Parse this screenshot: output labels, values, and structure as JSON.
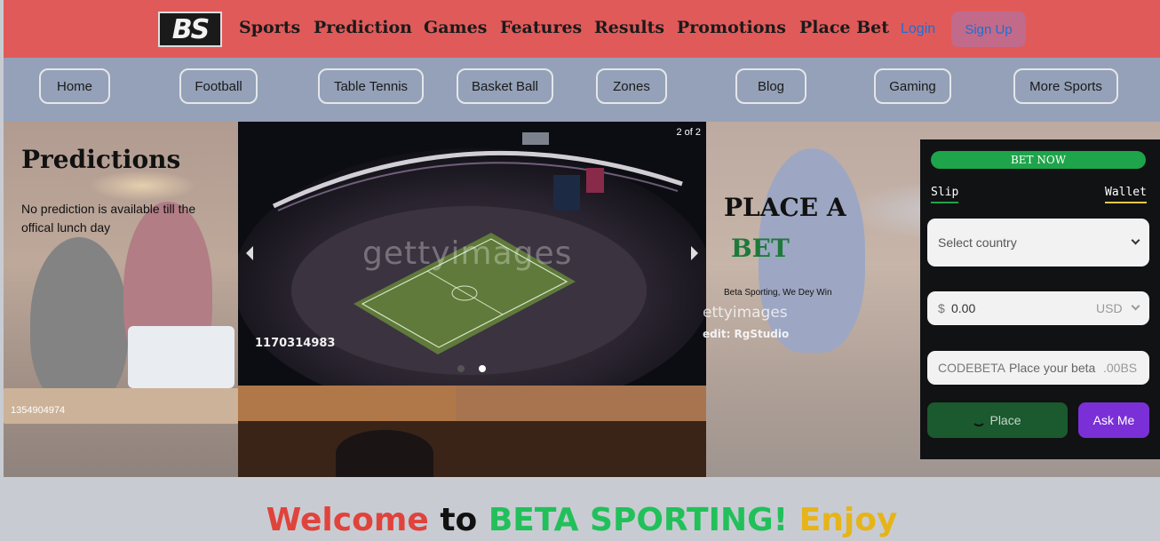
{
  "brand": {
    "logo_text": "BS"
  },
  "topnav": {
    "links": [
      "Sports",
      "Prediction",
      "Games",
      "Features",
      "Results",
      "Promotions",
      "Place Bet"
    ],
    "login": "Login",
    "signup": "Sign Up"
  },
  "subnav": {
    "items": [
      "Home",
      "Football",
      "Table Tennis",
      "Basket Ball",
      "Zones",
      "Blog",
      "Gaming",
      "More Sports"
    ]
  },
  "hero": {
    "predictions_title": "Predictions",
    "predictions_text": "No prediction is available till the offical lunch day",
    "image_ids": {
      "left_photo": "1354904974",
      "bottom_photo": "1354904974"
    },
    "carousel": {
      "counter": "2 of 2",
      "image_id": "1170314983",
      "watermark": "gettyimages",
      "total_slides": 2,
      "active_slide": 2
    },
    "place_bet": {
      "line1": "PLACE A",
      "line2": "BET",
      "tagline": "Beta Sporting, We Dey Win",
      "credit_watermark": "ettyimages",
      "credit_text": "edit: RgStudio"
    }
  },
  "bet_panel": {
    "header": "BET NOW",
    "tabs": {
      "slip": "Slip",
      "wallet": "Wallet"
    },
    "country_select": {
      "placeholder": "Select country"
    },
    "amount": {
      "currency_symbol": "$",
      "value": "0.00",
      "currency": "USD"
    },
    "code": {
      "prefix": "CODEBETA",
      "placeholder": "Place your beta",
      "suffix": ".00BS"
    },
    "place_button": "Place",
    "ask_button": "Ask Me"
  },
  "welcome": {
    "parts": [
      "Welcome",
      "to",
      "BETA SPORTING!",
      "Enjoy"
    ],
    "colors": [
      "#e0433c",
      "#111111",
      "#22c05a",
      "#e6b41a"
    ]
  },
  "colors": {
    "topnav_bg": "#e05a5a",
    "subnav_bg": "#94a1b8",
    "bet_green": "#1ea44a",
    "ask_purple": "#7a30d6",
    "link_blue": "#1a6fd6"
  }
}
